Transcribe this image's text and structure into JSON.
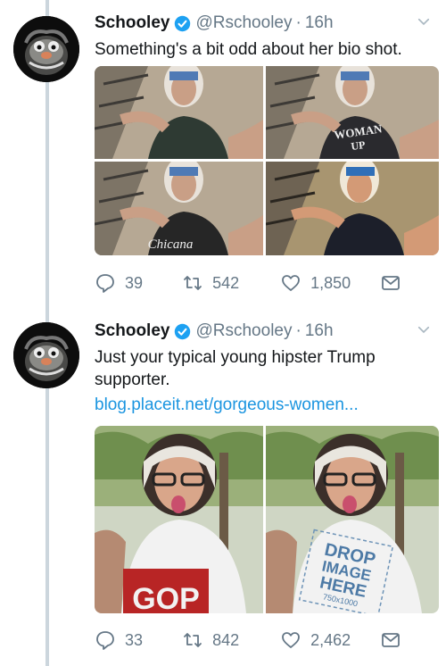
{
  "tweets": [
    {
      "author": {
        "name": "Schooley",
        "handle": "@Rschooley",
        "time": "16h",
        "avatar": "muppet-avatar"
      },
      "text": "Something's a bit odd about her bio shot.",
      "media": [
        {
          "label": "",
          "caption": "",
          "shirt": "#2e3a33"
        },
        {
          "label": "WOMAN UP",
          "caption": "",
          "shirt": "#2a2a2e"
        },
        {
          "label": "Chicana",
          "caption": "",
          "shirt": "#262626"
        },
        {
          "label": "",
          "caption": "",
          "shirt": "#1c1f2a"
        }
      ],
      "stats": {
        "replies": "39",
        "retweets": "542",
        "likes": "1,850"
      }
    },
    {
      "author": {
        "name": "Schooley",
        "handle": "@Rschooley",
        "time": "16h",
        "avatar": "muppet-avatar"
      },
      "text": "Just your typical young hipster Trump supporter.",
      "link": "blog.placeit.net/gorgeous-women...",
      "media": [
        {
          "label": "GOP"
        },
        {
          "label_line1": "DROP",
          "label_line2": "IMAGE",
          "label_line3": "HERE",
          "label_line4": "750x1000"
        }
      ],
      "stats": {
        "replies": "33",
        "retweets": "842",
        "likes": "2,462"
      }
    }
  ],
  "colors": {
    "verified": "#1da1f2",
    "link": "#1b95e0",
    "muted": "#657786",
    "thread": "#ccd6dd"
  }
}
